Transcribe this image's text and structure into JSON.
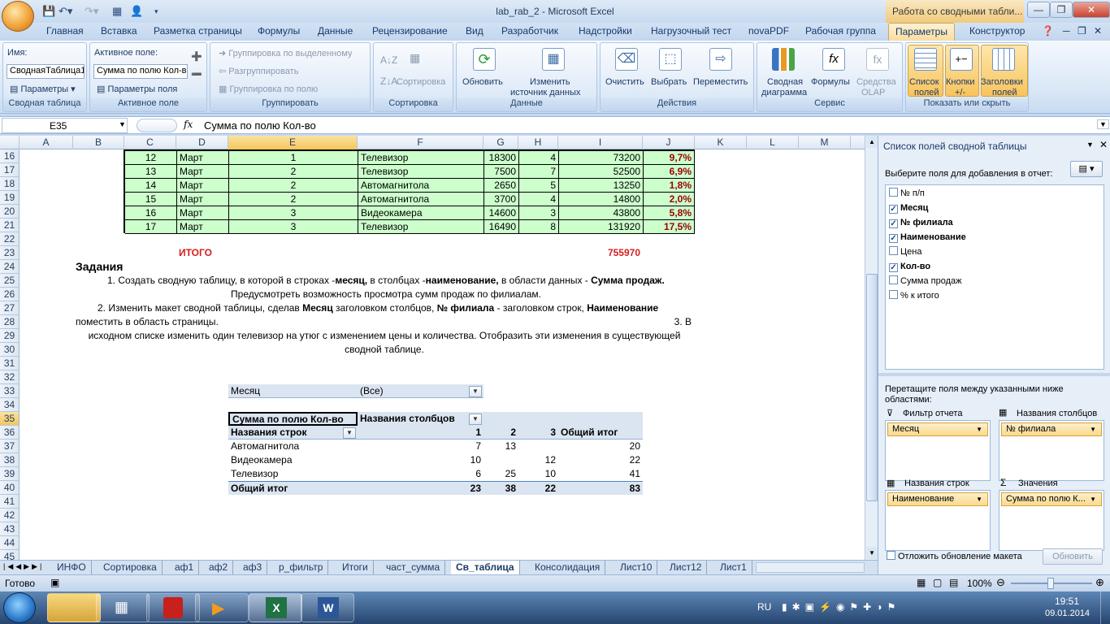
{
  "window": {
    "title": "lab_rab_2 - Microsoft Excel",
    "context_tab": "Работа со сводными табли..."
  },
  "tabs": [
    "Главная",
    "Вставка",
    "Разметка страницы",
    "Формулы",
    "Данные",
    "Рецензирование",
    "Вид",
    "Разработчик",
    "Надстройки",
    "Нагрузочный тест",
    "novaPDF",
    "Рабочая группа",
    "Параметры",
    "Конструктор"
  ],
  "ribbon": {
    "g1": {
      "name_label": "Имя:",
      "name_value": "СводнаяТаблица1",
      "params": "Параметры",
      "title": "Сводная таблица"
    },
    "g2": {
      "label": "Активное поле:",
      "value": "Сумма по полю Кол-в",
      "params": "Параметры поля",
      "title": "Активное поле"
    },
    "g3": {
      "a": "Группировка по выделенному",
      "b": "Разгруппировать",
      "c": "Группировка по полю",
      "title": "Группировать"
    },
    "g4": {
      "sort": "Сортировка",
      "title": "Сортировка"
    },
    "g5": {
      "refresh": "Обновить",
      "change1": "Изменить",
      "change2": "источник данных",
      "title": "Данные"
    },
    "g6": {
      "clear": "Очистить",
      "select": "Выбрать",
      "move": "Переместить",
      "title": "Действия"
    },
    "g7": {
      "chart1": "Сводная",
      "chart2": "диаграмма",
      "formulas": "Формулы",
      "olap1": "Средства",
      "olap2": "OLAP",
      "title": "Сервис"
    },
    "g8": {
      "list1": "Список",
      "list2": "полей",
      "btn1": "Кнопки",
      "btn2": "+/-",
      "hdr1": "Заголовки",
      "hdr2": "полей",
      "title": "Показать или скрыть"
    }
  },
  "formula_bar": {
    "cell": "E35",
    "fx": "fx",
    "formula": "Сумма по полю Кол-во"
  },
  "columns": [
    "A",
    "B",
    "C",
    "D",
    "E",
    "F",
    "G",
    "H",
    "I",
    "J",
    "K",
    "L",
    "M"
  ],
  "rows": [
    "16",
    "17",
    "18",
    "19",
    "20",
    "21",
    "22",
    "23",
    "24",
    "25",
    "26",
    "27",
    "28",
    "29",
    "30",
    "31",
    "32",
    "33",
    "34",
    "35",
    "36",
    "37",
    "38",
    "39",
    "40",
    "41",
    "42",
    "43",
    "44",
    "45"
  ],
  "data_rows": [
    [
      "12",
      "Март",
      "1",
      "Телевизор",
      "18300",
      "4",
      "73200",
      "9,7%"
    ],
    [
      "13",
      "Март",
      "2",
      "Телевизор",
      "7500",
      "7",
      "52500",
      "6,9%"
    ],
    [
      "14",
      "Март",
      "2",
      "Автомагнитола",
      "2650",
      "5",
      "13250",
      "1,8%"
    ],
    [
      "15",
      "Март",
      "2",
      "Автомагнитола",
      "3700",
      "4",
      "14800",
      "2,0%"
    ],
    [
      "16",
      "Март",
      "3",
      "Видеокамера",
      "14600",
      "3",
      "43800",
      "5,8%"
    ],
    [
      "17",
      "Март",
      "3",
      "Телевизор",
      "16490",
      "8",
      "131920",
      "17,5%"
    ]
  ],
  "total": {
    "label": "ИТОГО",
    "value": "755970"
  },
  "tasks": {
    "heading": "Задания",
    "t1a": "1. Создать сводную таблицу, в  которой в строках -",
    "t1b": "месяц,",
    "t1c": " в столбцах -",
    "t1d": "наименование,",
    "t1e": " в области данных - ",
    "t1f": "Сумма продаж.",
    "t1g": "Предусмотреть возможность просмотра сумм продаж по филиалам.",
    "t2a": "2. Изменить макет сводной таблицы, сделав ",
    "t2b": "Месяц",
    "t2c": " заголовком столбцов, ",
    "t2d": "№ филиала",
    "t2e": " - заголовком строк,  ",
    "t2f": "Наименование",
    "t2g": "поместить в область страницы.",
    "t3a": "3. В",
    "t3b": "исходном списке изменить один телевизор на утюг с изменением цены и количества. Отобразить эти изменения в существующей",
    "t3c": "сводной таблице."
  },
  "pivot": {
    "filter_label": "Месяц",
    "filter_value": "(Все)",
    "corner": "Сумма по полю Кол-во",
    "col_header": "Названия столбцов",
    "row_header": "Названия строк",
    "cols": [
      "1",
      "2",
      "3"
    ],
    "grand": "Общий итог",
    "rows": [
      {
        "name": "Автомагнитола",
        "v": [
          "7",
          "13",
          ""
        ],
        "t": "20"
      },
      {
        "name": "Видеокамера",
        "v": [
          "10",
          "",
          "12"
        ],
        "t": "22"
      },
      {
        "name": "Телевизор",
        "v": [
          "6",
          "25",
          "10"
        ],
        "t": "41"
      }
    ],
    "totals": {
      "name": "Общий итог",
      "v": [
        "23",
        "38",
        "22"
      ],
      "t": "83"
    }
  },
  "sheet_tabs": [
    "ИНФО",
    "Сортировка",
    "аф1",
    "аф2",
    "аф3",
    "р_фильтр",
    "Итоги",
    "част_сумма",
    "Св_таблица",
    "Консолидация",
    "Лист10",
    "Лист12",
    "Лист1"
  ],
  "status": {
    "ready": "Готово",
    "zoom": "100%"
  },
  "pane": {
    "title": "Список полей сводной таблицы",
    "prompt": "Выберите поля для добавления в отчет:",
    "fields": [
      {
        "name": "№ п/п",
        "checked": false
      },
      {
        "name": "Месяц",
        "checked": true
      },
      {
        "name": "№ филиала",
        "checked": true
      },
      {
        "name": "Наименование",
        "checked": true
      },
      {
        "name": "Цена",
        "checked": false
      },
      {
        "name": "Кол-во",
        "checked": true
      },
      {
        "name": "Сумма продаж",
        "checked": false
      },
      {
        "name": "% к итого",
        "checked": false
      }
    ],
    "drag1": "Перетащите поля между указанными ниже",
    "drag2": "областями:",
    "filter_area": "Фильтр отчета",
    "filter_chip": "Месяц",
    "cols_area": "Названия столбцов",
    "cols_chip": "№ филиала",
    "rows_area": "Названия строк",
    "rows_chip": "Наименование",
    "values_area": "Значения",
    "values_chip": "Сумма по полю К...",
    "defer": "Отложить обновление макета",
    "update": "Обновить"
  },
  "taskbar": {
    "lang": "RU",
    "time": "19:51",
    "date": "09.01.2014"
  }
}
